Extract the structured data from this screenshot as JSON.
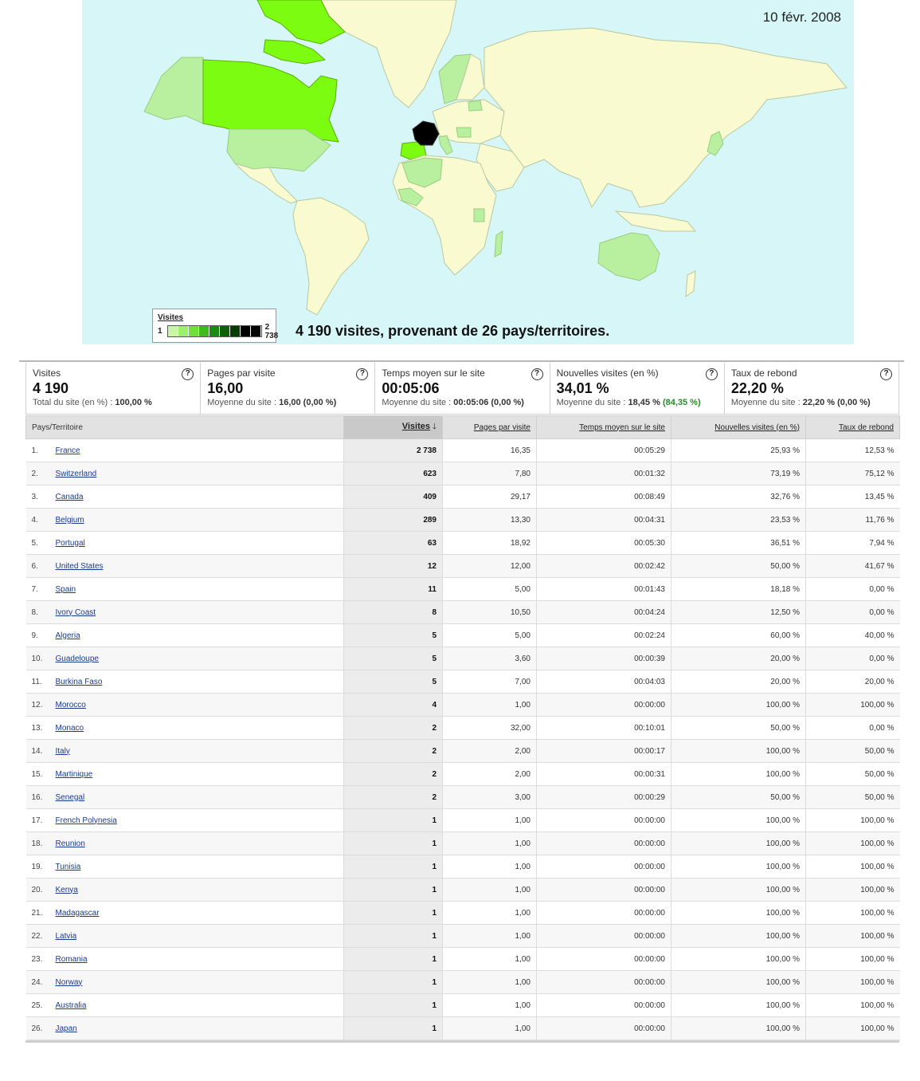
{
  "map": {
    "date": "10 févr. 2008",
    "legend_title": "Visites",
    "legend_min": "1",
    "legend_max": "2 738",
    "legend_colors": [
      "#c9f5a6",
      "#9ef06a",
      "#6fe03a",
      "#3dbd1d",
      "#1a8a10",
      "#0f5e08",
      "#073c04",
      "#000000",
      "#000000"
    ],
    "caption": "4 190 visites, provenant de 26 pays/territoires.",
    "colors": {
      "ocean": "#d6f6f8",
      "land": "#fafad0",
      "low": "#b8f0a0",
      "mid": "#7cfc10",
      "top": "#000000",
      "border": "#b8c8a0"
    }
  },
  "summary": [
    {
      "label": "Visites",
      "value": "4 190",
      "sub_text": "Total du site (en %) : ",
      "sub_bold": "100,00 %",
      "sub_delta": ""
    },
    {
      "label": "Pages par visite",
      "value": "16,00",
      "sub_text": "Moyenne du site : ",
      "sub_bold": "16,00 (0,00 %)",
      "sub_delta": ""
    },
    {
      "label": "Temps moyen sur le site",
      "value": "00:05:06",
      "sub_text": "Moyenne du site : ",
      "sub_bold": "00:05:06 (0,00 %)",
      "sub_delta": ""
    },
    {
      "label": "Nouvelles visites (en %)",
      "value": "34,01 %",
      "sub_text": "Moyenne du site : ",
      "sub_bold": "18,45 %",
      "sub_delta": "(84,35 %)"
    },
    {
      "label": "Taux de rebond",
      "value": "22,20 %",
      "sub_text": "Moyenne du site : ",
      "sub_bold": "22,20 % (0,00 %)",
      "sub_delta": ""
    }
  ],
  "help_glyph": "?",
  "table": {
    "headers": {
      "country": "Pays/Territoire",
      "visits": "Visites",
      "sort_arrow": "🡓",
      "pages": "Pages par visite",
      "time": "Temps moyen sur le site",
      "new": "Nouvelles visites (en %)",
      "bounce": "Taux de rebond"
    },
    "rows": [
      {
        "rank": "1.",
        "country": "France",
        "visits": "2 738",
        "pages": "16,35",
        "time": "00:05:29",
        "new": "25,93 %",
        "bounce": "12,53 %"
      },
      {
        "rank": "2.",
        "country": "Switzerland",
        "visits": "623",
        "pages": "7,80",
        "time": "00:01:32",
        "new": "73,19 %",
        "bounce": "75,12 %"
      },
      {
        "rank": "3.",
        "country": "Canada",
        "visits": "409",
        "pages": "29,17",
        "time": "00:08:49",
        "new": "32,76 %",
        "bounce": "13,45 %"
      },
      {
        "rank": "4.",
        "country": "Belgium",
        "visits": "289",
        "pages": "13,30",
        "time": "00:04:31",
        "new": "23,53 %",
        "bounce": "11,76 %"
      },
      {
        "rank": "5.",
        "country": "Portugal",
        "visits": "63",
        "pages": "18,92",
        "time": "00:05:30",
        "new": "36,51 %",
        "bounce": "7,94 %"
      },
      {
        "rank": "6.",
        "country": "United States",
        "visits": "12",
        "pages": "12,00",
        "time": "00:02:42",
        "new": "50,00 %",
        "bounce": "41,67 %"
      },
      {
        "rank": "7.",
        "country": "Spain",
        "visits": "11",
        "pages": "5,00",
        "time": "00:01:43",
        "new": "18,18 %",
        "bounce": "0,00 %"
      },
      {
        "rank": "8.",
        "country": "Ivory Coast",
        "visits": "8",
        "pages": "10,50",
        "time": "00:04:24",
        "new": "12,50 %",
        "bounce": "0,00 %"
      },
      {
        "rank": "9.",
        "country": "Algeria",
        "visits": "5",
        "pages": "5,00",
        "time": "00:02:24",
        "new": "60,00 %",
        "bounce": "40,00 %"
      },
      {
        "rank": "10.",
        "country": "Guadeloupe",
        "visits": "5",
        "pages": "3,60",
        "time": "00:00:39",
        "new": "20,00 %",
        "bounce": "0,00 %"
      },
      {
        "rank": "11.",
        "country": "Burkina Faso",
        "visits": "5",
        "pages": "7,00",
        "time": "00:04:03",
        "new": "20,00 %",
        "bounce": "20,00 %"
      },
      {
        "rank": "12.",
        "country": "Morocco",
        "visits": "4",
        "pages": "1,00",
        "time": "00:00:00",
        "new": "100,00 %",
        "bounce": "100,00 %"
      },
      {
        "rank": "13.",
        "country": "Monaco",
        "visits": "2",
        "pages": "32,00",
        "time": "00:10:01",
        "new": "50,00 %",
        "bounce": "0,00 %"
      },
      {
        "rank": "14.",
        "country": "Italy",
        "visits": "2",
        "pages": "2,00",
        "time": "00:00:17",
        "new": "100,00 %",
        "bounce": "50,00 %"
      },
      {
        "rank": "15.",
        "country": "Martinique",
        "visits": "2",
        "pages": "2,00",
        "time": "00:00:31",
        "new": "100,00 %",
        "bounce": "50,00 %"
      },
      {
        "rank": "16.",
        "country": "Senegal",
        "visits": "2",
        "pages": "3,00",
        "time": "00:00:29",
        "new": "50,00 %",
        "bounce": "50,00 %"
      },
      {
        "rank": "17.",
        "country": "French Polynesia",
        "visits": "1",
        "pages": "1,00",
        "time": "00:00:00",
        "new": "100,00 %",
        "bounce": "100,00 %"
      },
      {
        "rank": "18.",
        "country": "Reunion",
        "visits": "1",
        "pages": "1,00",
        "time": "00:00:00",
        "new": "100,00 %",
        "bounce": "100,00 %"
      },
      {
        "rank": "19.",
        "country": "Tunisia",
        "visits": "1",
        "pages": "1,00",
        "time": "00:00:00",
        "new": "100,00 %",
        "bounce": "100,00 %"
      },
      {
        "rank": "20.",
        "country": "Kenya",
        "visits": "1",
        "pages": "1,00",
        "time": "00:00:00",
        "new": "100,00 %",
        "bounce": "100,00 %"
      },
      {
        "rank": "21.",
        "country": "Madagascar",
        "visits": "1",
        "pages": "1,00",
        "time": "00:00:00",
        "new": "100,00 %",
        "bounce": "100,00 %"
      },
      {
        "rank": "22.",
        "country": "Latvia",
        "visits": "1",
        "pages": "1,00",
        "time": "00:00:00",
        "new": "100,00 %",
        "bounce": "100,00 %"
      },
      {
        "rank": "23.",
        "country": "Romania",
        "visits": "1",
        "pages": "1,00",
        "time": "00:00:00",
        "new": "100,00 %",
        "bounce": "100,00 %"
      },
      {
        "rank": "24.",
        "country": "Norway",
        "visits": "1",
        "pages": "1,00",
        "time": "00:00:00",
        "new": "100,00 %",
        "bounce": "100,00 %"
      },
      {
        "rank": "25.",
        "country": "Australia",
        "visits": "1",
        "pages": "1,00",
        "time": "00:00:00",
        "new": "100,00 %",
        "bounce": "100,00 %"
      },
      {
        "rank": "26.",
        "country": "Japan",
        "visits": "1",
        "pages": "1,00",
        "time": "00:00:00",
        "new": "100,00 %",
        "bounce": "100,00 %"
      }
    ]
  }
}
